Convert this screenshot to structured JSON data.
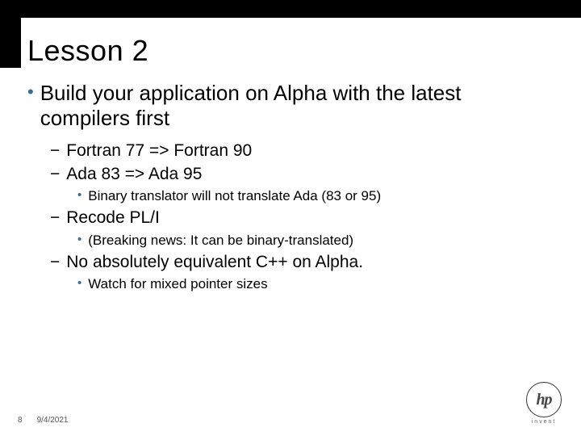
{
  "title": "Lesson 2",
  "bullets": {
    "main": "Build your application on Alpha with the latest compilers first",
    "sub": [
      {
        "text": "Fortran 77 => Fortran 90"
      },
      {
        "text": "Ada 83 => Ada 95",
        "notes": [
          "Binary translator will not translate Ada (83 or 95)"
        ]
      },
      {
        "text": "Recode PL/I",
        "notes": [
          "(Breaking news: It can be binary-translated)"
        ]
      },
      {
        "text": "No absolutely equivalent C++ on Alpha.",
        "notes": [
          "Watch for mixed pointer sizes"
        ]
      }
    ]
  },
  "footer": {
    "page": "8",
    "date": "9/4/2021"
  },
  "logo": {
    "mark": "hp",
    "sub": "invent"
  }
}
